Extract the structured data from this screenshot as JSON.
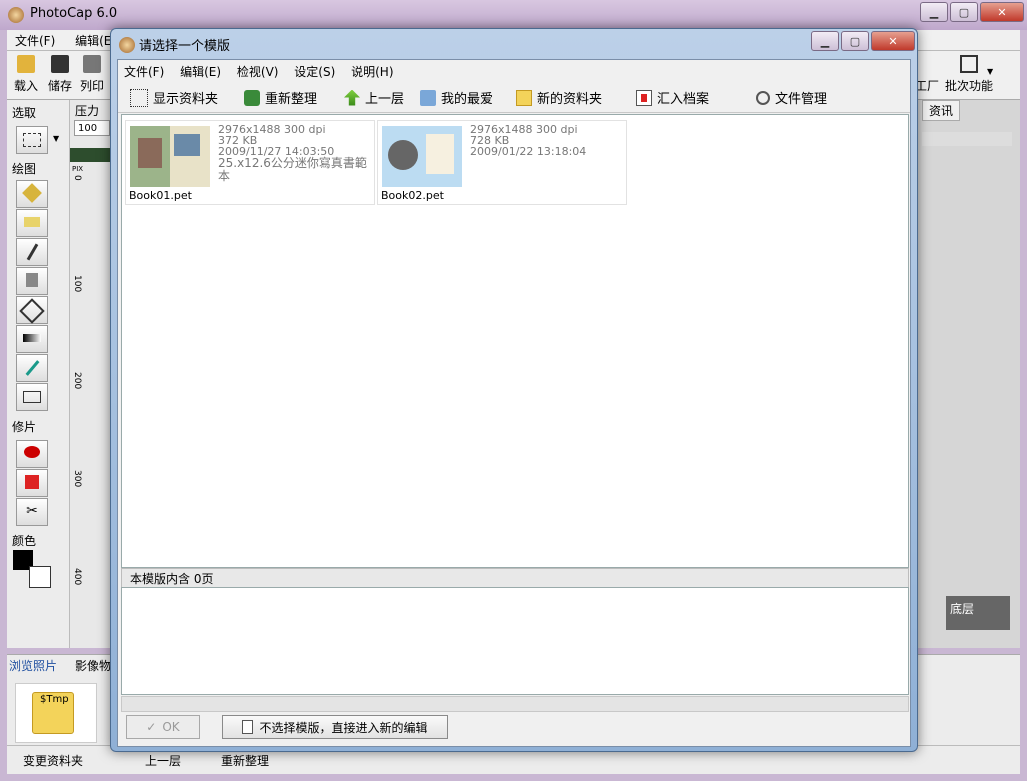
{
  "app": {
    "title": "PhotoCap 6.0",
    "menu": [
      "文件(F)",
      "编辑(E"
    ],
    "toolbar": [
      "载入",
      "储存",
      "列印"
    ],
    "toolbar_right": [
      "工厂",
      "批次功能"
    ],
    "left_panel": {
      "select_label": "选取",
      "pressure_label": "压力",
      "pressure_value": "100",
      "draw_label": "绘图",
      "retouch_label": "修片",
      "color_label": "颜色"
    },
    "ruler_unit": "PIX",
    "ruler_ticks": [
      "0",
      "100",
      "200",
      "300",
      "400"
    ],
    "right_tab": "资讯",
    "layer_label": "底层",
    "bottom_tabs": [
      "浏览照片",
      "影像物"
    ],
    "folder_name": "$Tmp",
    "status": [
      "变更资料夹",
      "上一层",
      "重新整理"
    ]
  },
  "dialog": {
    "title": "请选择一个模版",
    "menu": [
      "文件(F)",
      "编辑(E)",
      "检视(V)",
      "设定(S)",
      "说明(H)"
    ],
    "toolbar": [
      "显示资料夹",
      "重新整理",
      "上一层",
      "我的最爱",
      "新的资料夹",
      "汇入档案",
      "文件管理"
    ],
    "files": [
      {
        "name": "Book01.pet",
        "resolution": "2976x1488 300 dpi",
        "size": "372 KB",
        "date": "2009/11/27 14:03:50",
        "desc": "25.x12.6公分迷你寫真書範本"
      },
      {
        "name": "Book02.pet",
        "resolution": "2976x1488 300 dpi",
        "size": "728 KB",
        "date": "2009/01/22 13:18:04",
        "desc": ""
      }
    ],
    "summary": "本模版内含 0页",
    "ok_label": "OK",
    "skip_label": "不选择模版，直接进入新的编辑"
  },
  "colors": {
    "dialog_title_bg": "#bcd0e8",
    "close_button": "#c0392b"
  }
}
